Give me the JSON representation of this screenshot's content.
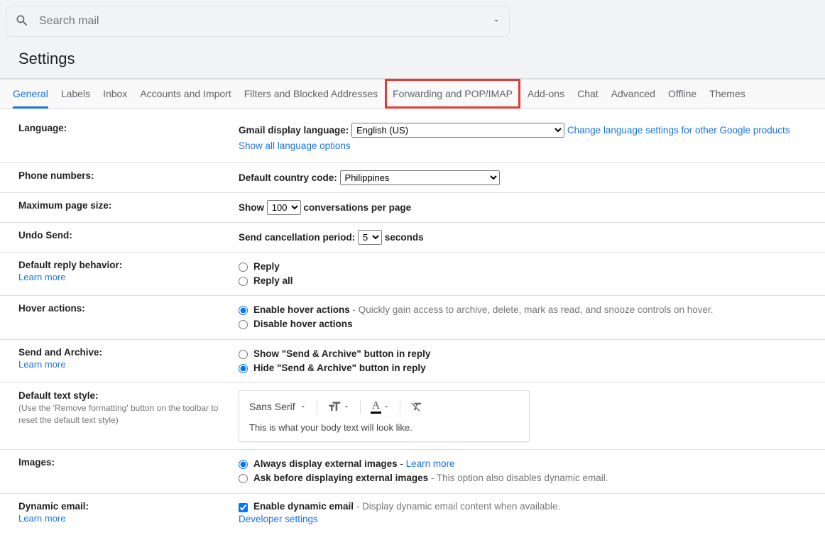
{
  "search": {
    "placeholder": "Search mail"
  },
  "heading": "Settings",
  "tabs": [
    {
      "label": "General",
      "active": true
    },
    {
      "label": "Labels"
    },
    {
      "label": "Inbox"
    },
    {
      "label": "Accounts and Import"
    },
    {
      "label": "Filters and Blocked Addresses"
    },
    {
      "label": "Forwarding and POP/IMAP",
      "highlight": true
    },
    {
      "label": "Add-ons"
    },
    {
      "label": "Chat"
    },
    {
      "label": "Advanced"
    },
    {
      "label": "Offline"
    },
    {
      "label": "Themes"
    }
  ],
  "lang": {
    "label": "Language:",
    "display_label": "Gmail display language:",
    "value": "English (US)",
    "change_link": "Change language settings for other Google products",
    "show_all": "Show all language options"
  },
  "phone": {
    "label": "Phone numbers:",
    "cc_label": "Default country code:",
    "value": "Philippines"
  },
  "pagesize": {
    "label": "Maximum page size:",
    "pre": "Show",
    "value": "100",
    "post": "conversations per page"
  },
  "undo": {
    "label": "Undo Send:",
    "pre": "Send cancellation period:",
    "value": "5",
    "post": "seconds"
  },
  "reply": {
    "label": "Default reply behavior:",
    "learn": "Learn more",
    "opt1": "Reply",
    "opt2": "Reply all"
  },
  "hover": {
    "label": "Hover actions:",
    "opt1": "Enable hover actions",
    "opt1_desc": " - Quickly gain access to archive, delete, mark as read, and snooze controls on hover.",
    "opt2": "Disable hover actions"
  },
  "archive": {
    "label": "Send and Archive:",
    "learn": "Learn more",
    "opt1": "Show \"Send & Archive\" button in reply",
    "opt2": "Hide \"Send & Archive\" button in reply"
  },
  "textstyle": {
    "label": "Default text style:",
    "sub": "(Use the 'Remove formatting' button on the toolbar to reset the default text style)",
    "font": "Sans Serif",
    "sample": "This is what your body text will look like."
  },
  "images": {
    "label": "Images:",
    "opt1": "Always display external images",
    "opt1_link": "Learn more",
    "opt2": "Ask before displaying external images",
    "opt2_desc": " - This option also disables dynamic email."
  },
  "dynamic": {
    "label": "Dynamic email:",
    "learn": "Learn more",
    "chk": "Enable dynamic email",
    "desc": " - Display dynamic email content when available.",
    "dev": "Developer settings"
  }
}
